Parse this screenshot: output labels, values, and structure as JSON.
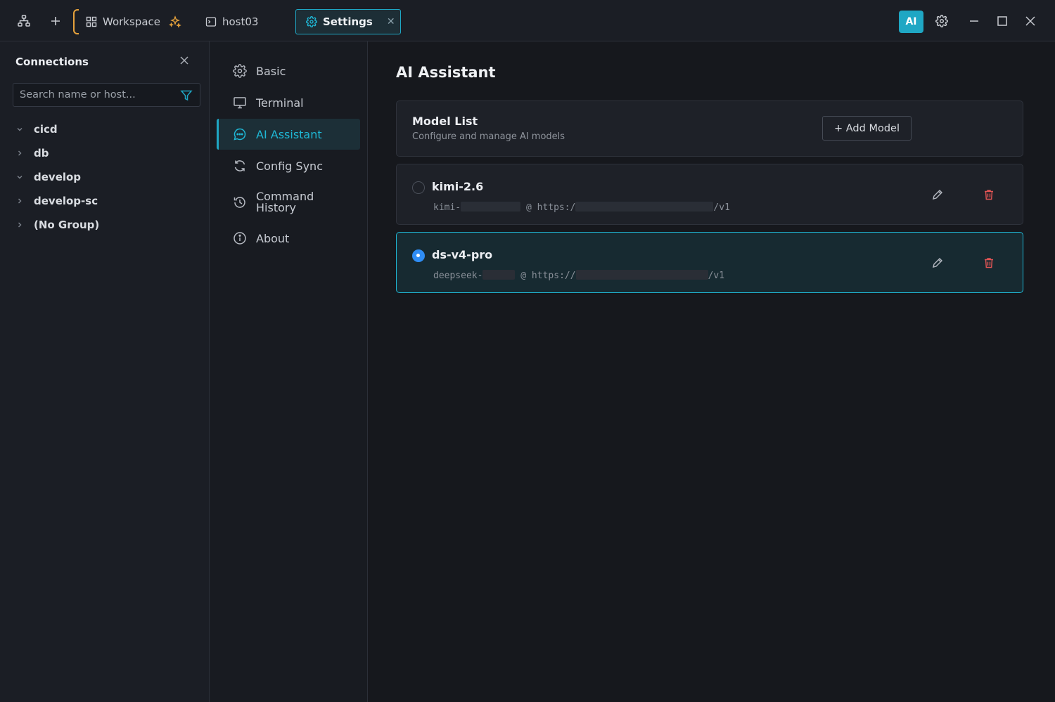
{
  "titlebar": {
    "tabs": {
      "workspace": "Workspace",
      "host": "host03",
      "settings": "Settings"
    },
    "ai_badge": "AI",
    "icons": [
      "network-icon",
      "plus-icon",
      "grid-icon",
      "sparkle-icon",
      "terminal-icon",
      "gear-icon",
      "close-icon",
      "minimize-icon",
      "maximize-icon"
    ],
    "accent_color": "#1fa7c4",
    "workspace_accent": "#e6a23c"
  },
  "connections": {
    "title": "Connections",
    "search_placeholder": "Search name or host...",
    "groups": [
      {
        "label": "cicd",
        "expanded": true
      },
      {
        "label": "db",
        "expanded": false
      },
      {
        "label": "develop",
        "expanded": true
      },
      {
        "label": "develop-sc",
        "expanded": false
      },
      {
        "label": "(No Group)",
        "expanded": false
      }
    ]
  },
  "settings_nav": {
    "items": [
      {
        "label": "Basic",
        "icon": "gear-icon"
      },
      {
        "label": "Terminal",
        "icon": "monitor-icon"
      },
      {
        "label": "AI Assistant",
        "icon": "chat-icon",
        "active": true
      },
      {
        "label": "Config Sync",
        "icon": "sync-icon"
      },
      {
        "label_line1": "Command",
        "label_line2": "History",
        "icon": "history-icon"
      },
      {
        "label": "About",
        "icon": "info-icon"
      }
    ]
  },
  "main": {
    "title": "AI Assistant",
    "model_list": {
      "title": "Model List",
      "subtitle": "Configure and manage AI models",
      "add_button": "+ Add Model"
    },
    "models": [
      {
        "name": "kimi-2.6",
        "model_prefix": "kimi-",
        "at": "@ https:/",
        "suffix": "/v1",
        "selected": false
      },
      {
        "name": "ds-v4-pro",
        "model_prefix": "deepseek-",
        "at": "@ https://",
        "suffix": "/v1",
        "selected": true
      }
    ],
    "delete_color": "#e25555",
    "radio_color": "#2f8df5"
  }
}
